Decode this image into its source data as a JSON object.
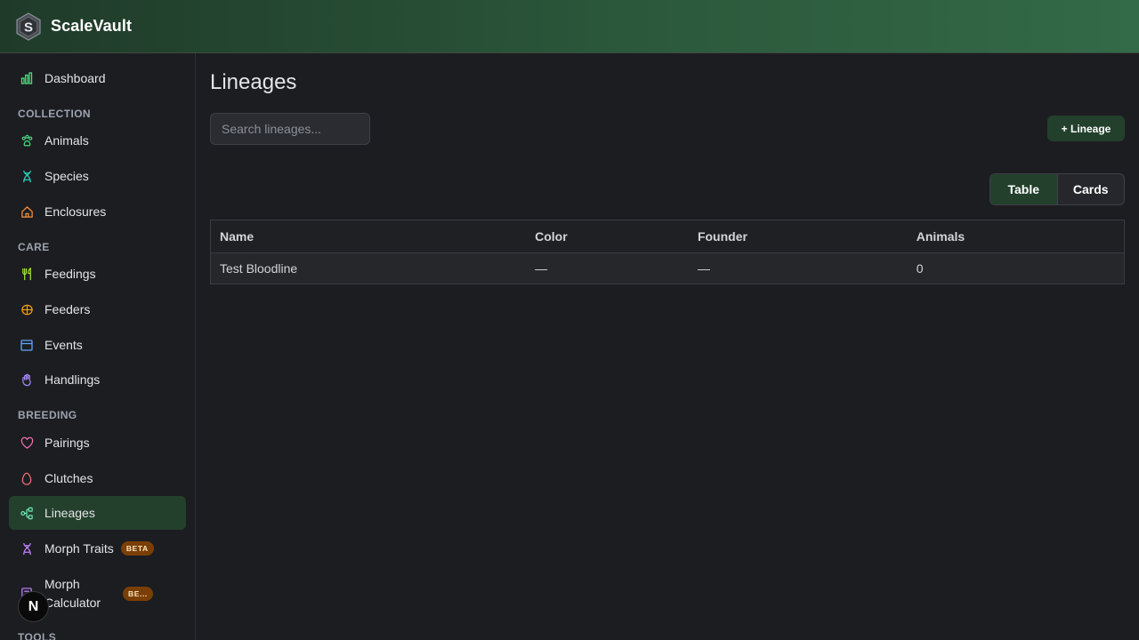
{
  "app": {
    "title": "ScaleVault"
  },
  "sidebar": {
    "dashboard": "Dashboard",
    "sections": {
      "collection": "COLLECTION",
      "care": "CARE",
      "breeding": "BREEDING",
      "tools": "TOOLS"
    },
    "items": {
      "animals": "Animals",
      "species": "Species",
      "enclosures": "Enclosures",
      "feedings": "Feedings",
      "feeders": "Feeders",
      "events": "Events",
      "handlings": "Handlings",
      "pairings": "Pairings",
      "clutches": "Clutches",
      "lineages": "Lineages",
      "morph_traits": "Morph Traits",
      "morph_calculator": "Morph Calculator"
    },
    "badges": {
      "morph_traits": "BETA",
      "morph_calculator": "BE..."
    },
    "active": "lineages",
    "next_button": "N"
  },
  "main": {
    "title": "Lineages",
    "search": {
      "placeholder": "Search lineages...",
      "value": ""
    },
    "add_button": "+ Lineage",
    "view_toggle": {
      "table": "Table",
      "cards": "Cards",
      "selected": "table"
    },
    "table": {
      "columns": [
        "Name",
        "Color",
        "Founder",
        "Animals"
      ],
      "rows": [
        [
          "Test Bloodline",
          "—",
          "—",
          "0"
        ]
      ]
    }
  },
  "colors": {
    "brand_green": "#23402c",
    "header_gradient_start": "#1f3a29",
    "header_gradient_end": "#336a47",
    "badge": "#7a3f06"
  }
}
